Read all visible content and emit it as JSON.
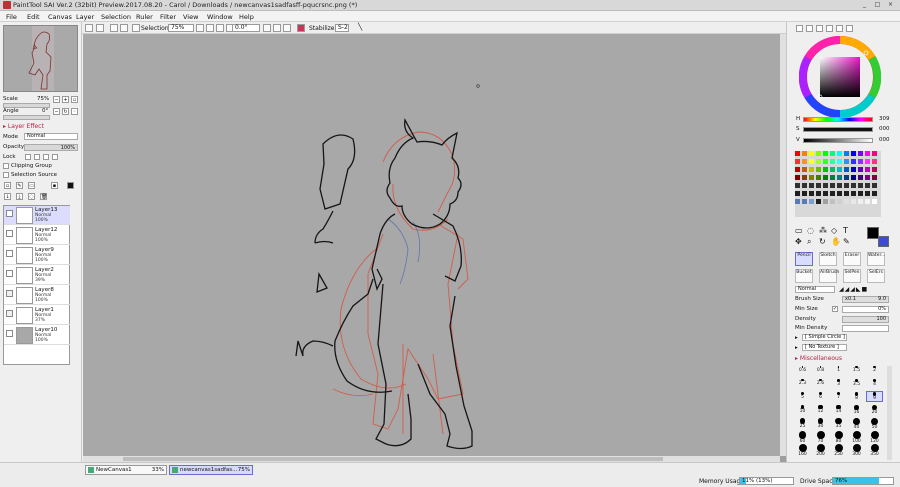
{
  "window": {
    "title": "PaintTool SAI Ver.2 (32bit) Preview.2017.08.20 - Carol / Downloads / newcanvas1sadfasff-pqucrsnc.png (*)",
    "controls": [
      "_",
      "□",
      "×"
    ]
  },
  "menu": [
    "File",
    "Edit",
    "Canvas",
    "Layer",
    "Selection",
    "Ruler",
    "Filter",
    "View",
    "Window",
    "Help"
  ],
  "toolbar": {
    "selection_label": "Selection",
    "zoom": "75%",
    "rotation": "0.0°",
    "stabilizer_label": "Stabilizer",
    "stabilizer_value": "S-2"
  },
  "navigator": {
    "scale_label": "Scale",
    "scale_value": "75%",
    "angle_label": "Angle",
    "angle_value": "0°"
  },
  "layer_props": {
    "effect_title": "Layer Effect",
    "mode_label": "Mode",
    "mode_value": "Normal",
    "opacity_label": "Opacity",
    "opacity_value": "100%",
    "lock_label": "Lock",
    "clipping_group": "Clipping Group",
    "selection_source": "Selection Source"
  },
  "layers": [
    {
      "name": "Layer13",
      "mode": "Normal",
      "opacity": "100%",
      "selected": true
    },
    {
      "name": "Layer12",
      "mode": "Normal",
      "opacity": "100%",
      "selected": false
    },
    {
      "name": "Layer9",
      "mode": "Normal",
      "opacity": "100%",
      "selected": false
    },
    {
      "name": "Layer2",
      "mode": "Normal",
      "opacity": "39%",
      "selected": false
    },
    {
      "name": "Layer8",
      "mode": "Normal",
      "opacity": "100%",
      "selected": false
    },
    {
      "name": "Layer1",
      "mode": "Normal",
      "opacity": "37%",
      "selected": false
    },
    {
      "name": "Layer10",
      "mode": "Normal",
      "opacity": "100%",
      "selected": false
    }
  ],
  "color": {
    "h_label": "H",
    "h_value": "309",
    "s_label": "S",
    "s_value": "000",
    "v_label": "V",
    "v_value": "000",
    "foreground": "#000000",
    "background": "#3c4fc8"
  },
  "tools": [
    {
      "label": "Pencil",
      "selected": true
    },
    {
      "label": "Sketch",
      "selected": false
    },
    {
      "label": "Eraser",
      "selected": false
    },
    {
      "label": "Water...",
      "selected": false
    },
    {
      "label": "Bucket",
      "selected": false
    },
    {
      "label": "AirBrush",
      "selected": false
    },
    {
      "label": "SelPen",
      "selected": false
    },
    {
      "label": "SelErs",
      "selected": false
    }
  ],
  "brush": {
    "blend_mode": "Normal",
    "size_label": "Brush Size",
    "size_mult": "x0.1",
    "size_value": "9.0",
    "min_size_label": "Min Size",
    "min_size_value": "0%",
    "density_label": "Density",
    "density_value": "100",
    "min_density_label": "Min Density",
    "shape": "[ Simple Circle ]",
    "texture": "[ No Texture ]",
    "misc": "Miscellaneous"
  },
  "brush_sizes": [
    "0.6",
    "0.8",
    "1",
    "1.5",
    "2",
    "2.3",
    "2.6",
    "3",
    "3.5",
    "4",
    "5",
    "6",
    "7",
    "8",
    "9",
    "10",
    "12",
    "14",
    "16",
    "20",
    "25",
    "30",
    "35",
    "40",
    "50",
    "60",
    "70",
    "80",
    "100",
    "120",
    "160",
    "200",
    "250",
    "300",
    "350"
  ],
  "documents": [
    {
      "name": "NewCanvas1",
      "zoom": "33%",
      "active": false
    },
    {
      "name": "newcanvas1sadfas...",
      "zoom": "75%",
      "active": true
    }
  ],
  "status": {
    "memory_label": "Memory Usage",
    "memory_value": "11% (13%)",
    "memory_pct": 11,
    "drive_label": "Drive Space",
    "drive_value": "76%",
    "drive_pct": 76
  }
}
